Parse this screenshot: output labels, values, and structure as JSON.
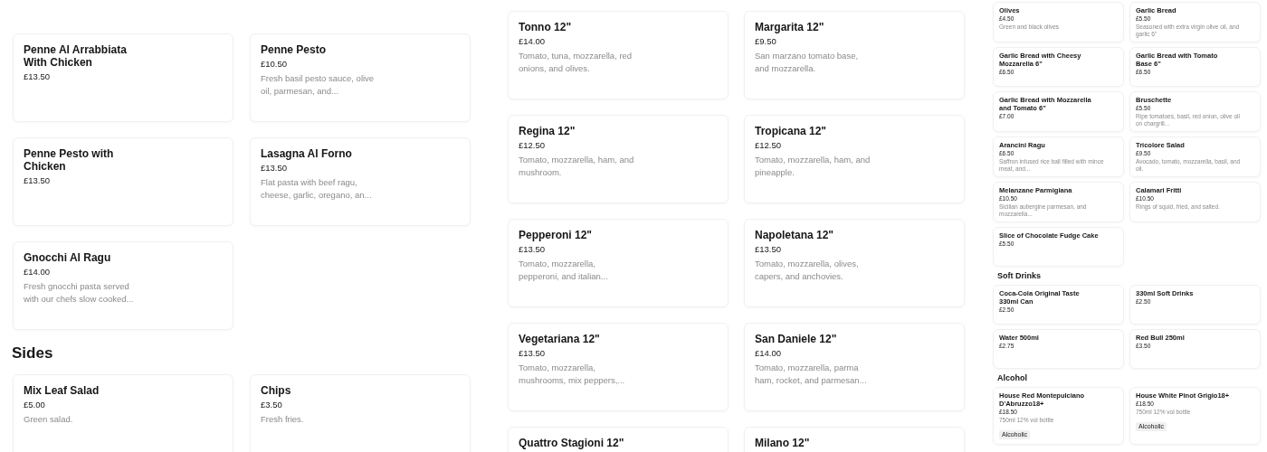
{
  "panels": [
    {
      "sections": [
        {
          "items": [
            {
              "name": "Penne Al Arrabbiata With Chicken",
              "price": "£13.50"
            },
            {
              "name": "Penne Pesto",
              "price": "£10.50",
              "description": "Fresh basil pesto sauce, olive oil, parmesan, and..."
            },
            {
              "name": "Penne Pesto with Chicken",
              "price": "£13.50"
            },
            {
              "name": "Lasagna Al Forno",
              "price": "£13.50",
              "description": "Flat pasta with beef ragu, cheese, garlic, oregano, an..."
            },
            {
              "name": "Gnocchi Al Ragu",
              "price": "£14.00",
              "description": "Fresh gnocchi pasta served with our chefs slow cooked..."
            }
          ]
        },
        {
          "heading": "Sides",
          "items": [
            {
              "name": "Mix Leaf Salad",
              "price": "£5.00",
              "description": "Green salad."
            },
            {
              "name": "Chips",
              "price": "£3.50",
              "description": "Fresh fries."
            }
          ]
        }
      ]
    },
    {
      "sections": [
        {
          "items": [
            {
              "name": "Tonno 12\"",
              "price": "£14.00",
              "description": "Tomato, tuna, mozzarella, red onions, and olives."
            },
            {
              "name": "Margarita 12\"",
              "price": "£9.50",
              "description": "San marzano tomato base, and mozzarella."
            },
            {
              "name": "Regina 12\"",
              "price": "£12.50",
              "description": "Tomato, mozzarella, ham, and mushroom."
            },
            {
              "name": "Tropicana 12\"",
              "price": "£12.50",
              "description": "Tomato, mozzarella, ham, and pineapple."
            },
            {
              "name": "Pepperoni 12\"",
              "price": "£13.50",
              "description": "Tomato, mozzarella, pepperoni, and italian..."
            },
            {
              "name": "Napoletana 12\"",
              "price": "£13.50",
              "description": "Tomato, mozzarella, olives, capers, and anchovies."
            },
            {
              "name": "Vegetariana 12\"",
              "price": "£13.50",
              "description": "Tomato, mozzarella, mushrooms, mix peppers,..."
            },
            {
              "name": "San Daniele 12\"",
              "price": "£14.00",
              "description": "Tomato, mozzarella, parma ham, rocket, and parmesan..."
            },
            {
              "name": "Quattro Stagioni 12\""
            },
            {
              "name": "Milano 12\""
            }
          ]
        }
      ]
    },
    {
      "sections": [
        {
          "items": [
            {
              "name": "Olives",
              "price": "£4.50",
              "description": "Green and black olives"
            },
            {
              "name": "Garlic Bread",
              "price": "£5.50",
              "description": "Seasoned with extra virgin olive oil, and garlic 6\""
            },
            {
              "name": "Garlic Bread with Cheesy Mozzarella 6\"",
              "price": "£6.50"
            },
            {
              "name": "Garlic Bread with Tomato Base 6\"",
              "price": "£6.50"
            },
            {
              "name": "Garlic Bread with Mozzarella and Tomato 6\"",
              "price": "£7.00"
            },
            {
              "name": "Bruschette",
              "price": "£5.50",
              "description": "Ripe tomatoes, basil, red onion, olive oil on chargrill..."
            },
            {
              "name": "Arancini Ragu",
              "price": "£6.50",
              "description": "Saffron infused rice ball filled with mince meat, and..."
            },
            {
              "name": "Tricolore Salad",
              "price": "£9.50",
              "description": "Avocado, tomato, mozzarella, basil, and oil."
            },
            {
              "name": "Melanzane Parmigiana",
              "price": "£10.50",
              "description": "Sicilian aubergine parmesan, and mozzarella..."
            },
            {
              "name": "Calamari Fritti",
              "price": "£10.50",
              "description": "Rings of squid, fried, and salted."
            },
            {
              "name": "Slice of Chocolate Fudge Cake",
              "price": "£5.50"
            }
          ]
        },
        {
          "heading": "Soft Drinks",
          "items": [
            {
              "name": "Coca-Cola Original Taste 330ml Can",
              "price": "£2.50"
            },
            {
              "name": "330ml Soft Drinks",
              "price": "£2.50"
            },
            {
              "name": "Water 500ml",
              "price": "£2.75"
            },
            {
              "name": "Red Bull 250ml",
              "price": "£3.50"
            }
          ]
        },
        {
          "heading": "Alcohol",
          "items": [
            {
              "name": "House Red Montepulciano D'Abruzzo18+",
              "price": "£18.50",
              "description": "750ml 12% vol bottle",
              "tag": "Alcoholic"
            },
            {
              "name": "House White Pinot Grigio18+",
              "price": "£18.50",
              "description": "750ml 12% vol bottle",
              "tag": "Alcoholic"
            }
          ]
        }
      ]
    }
  ]
}
